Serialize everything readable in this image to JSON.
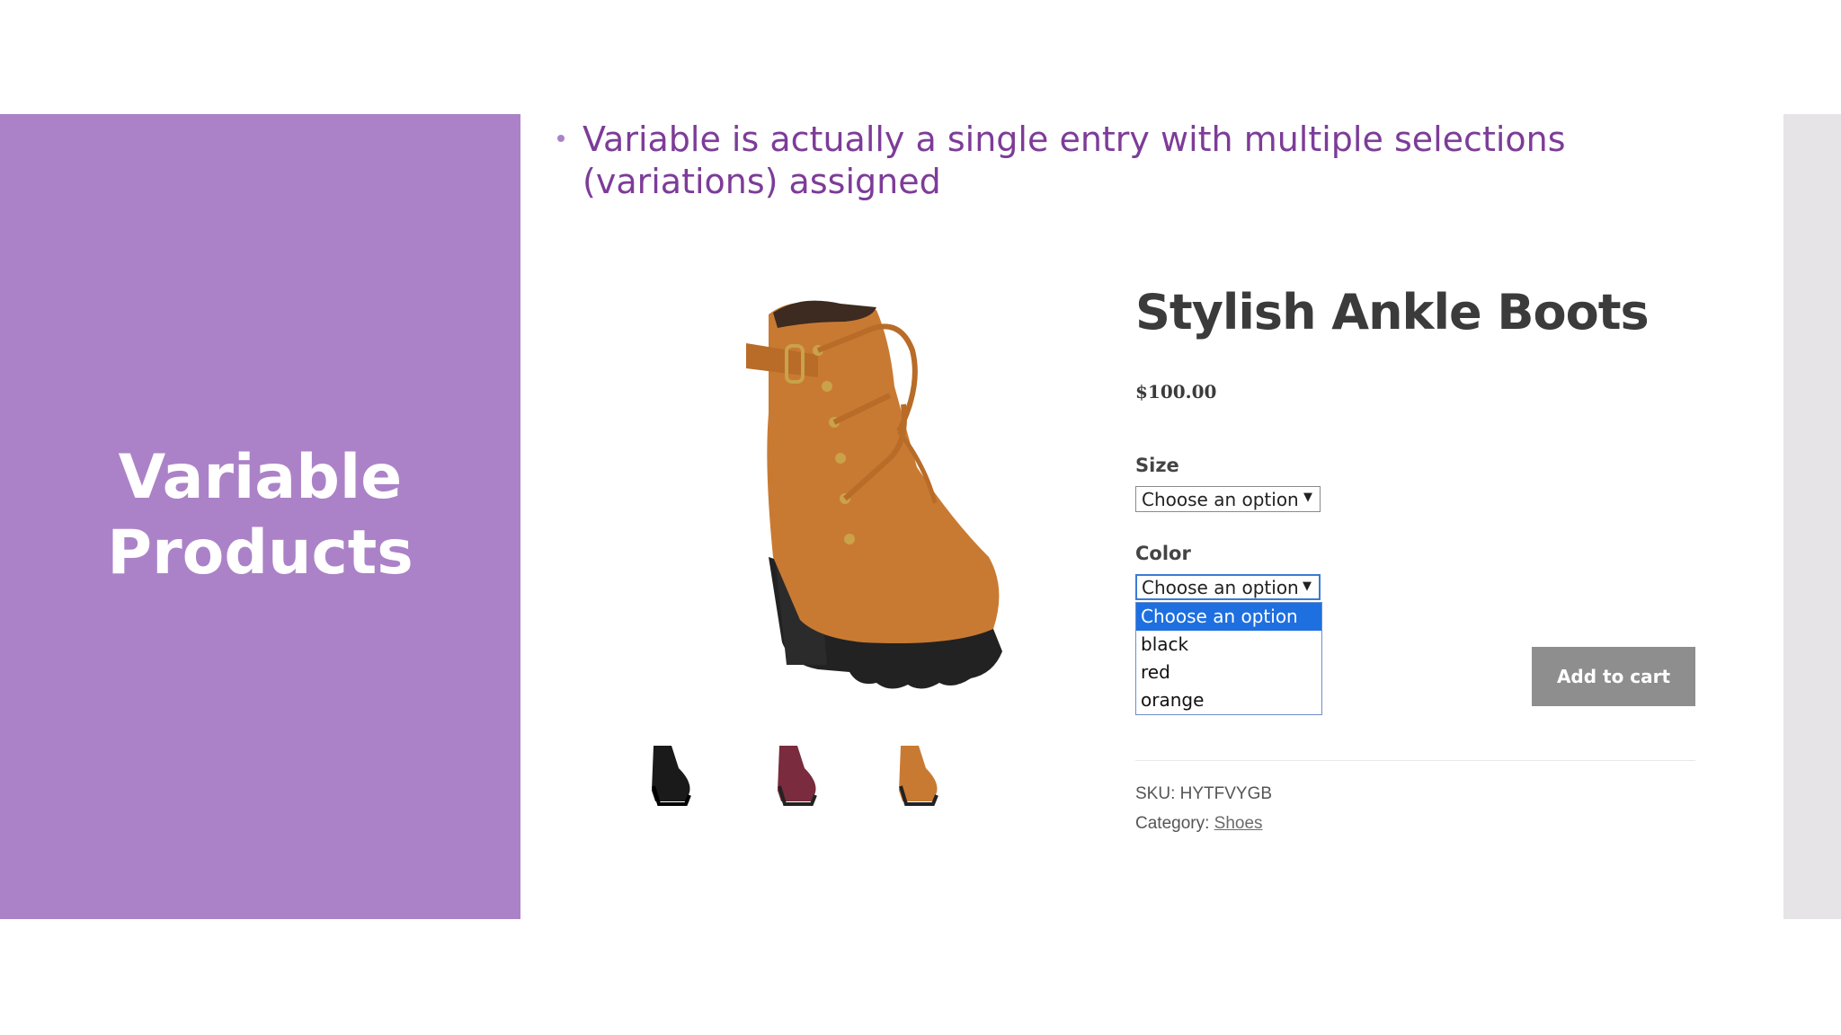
{
  "slide": {
    "title_line1": "Variable",
    "title_line2": "Products",
    "bullet": "Variable is actually a single entry with multiple selections (variations) assigned"
  },
  "product": {
    "name": "Stylish Ankle Boots",
    "price": "$100.00",
    "size_label": "Size",
    "size_value": "Choose an option",
    "color_label": "Color",
    "color_value": "Choose an option",
    "color_options": [
      "Choose an option",
      "black",
      "red",
      "orange"
    ],
    "selected_color_index": 0,
    "add_to_cart": "Add to cart",
    "sku_label": "SKU:",
    "sku_value": "HYTFVYGB",
    "category_label": "Category:",
    "category_value": "Shoes"
  },
  "colors": {
    "panel": "#ab82c7",
    "bullet_text": "#7d3c98",
    "boot_orange": "#c97a32",
    "boot_black": "#1a1a1a",
    "boot_red": "#7a2b3d",
    "select_highlight": "#1e6fe0",
    "button": "#8e8e8e"
  }
}
